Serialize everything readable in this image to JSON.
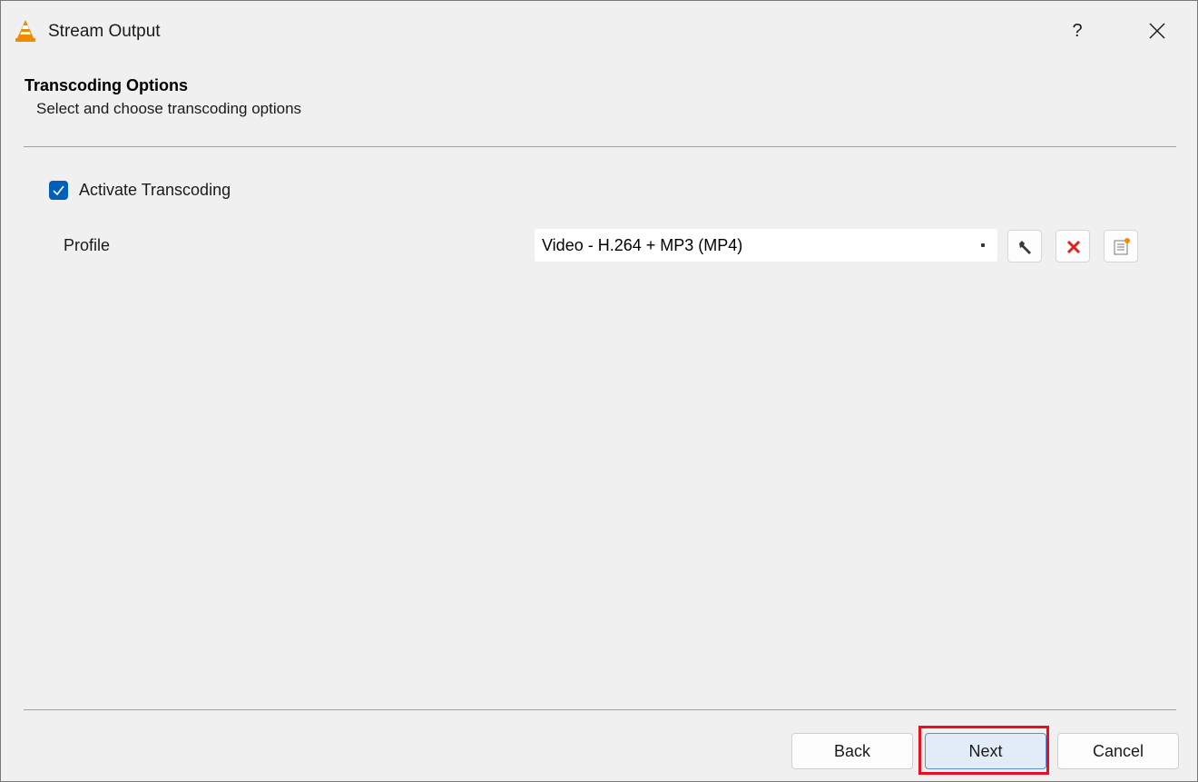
{
  "window": {
    "title": "Stream Output",
    "help_label": "?",
    "icons": {
      "app": "vlc-cone-icon",
      "close": "close-icon"
    }
  },
  "header": {
    "title": "Transcoding Options",
    "subtitle": "Select and choose transcoding options"
  },
  "transcoding": {
    "activate_label": "Activate Transcoding",
    "activate_checked": true,
    "profile_label": "Profile",
    "profile_value": "Video - H.264 + MP3 (MP4)",
    "profile_tools": [
      {
        "name": "edit-profile-button",
        "icon": "wrench-icon"
      },
      {
        "name": "delete-profile-button",
        "icon": "red-x-icon"
      },
      {
        "name": "new-profile-button",
        "icon": "new-list-icon"
      }
    ]
  },
  "footer": {
    "back_label": "Back",
    "next_label": "Next",
    "cancel_label": "Cancel"
  },
  "colors": {
    "accent": "#005fb8",
    "highlight": "#e81123",
    "delete_red": "#e21f1f"
  }
}
